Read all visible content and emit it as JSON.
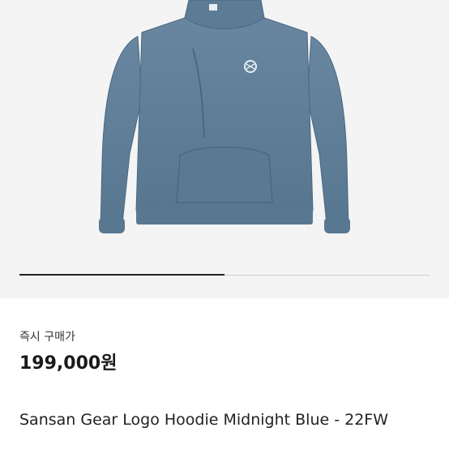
{
  "product": {
    "image_alt": "hoodie",
    "image_icon": "hoodie-photo",
    "garment_color": "#5f7f96",
    "buy_label": "즉시 구매가",
    "price": "199,000원",
    "title": "Sansan Gear Logo Hoodie Midnight Blue - 22FW"
  },
  "carousel": {
    "position": 0.5
  }
}
